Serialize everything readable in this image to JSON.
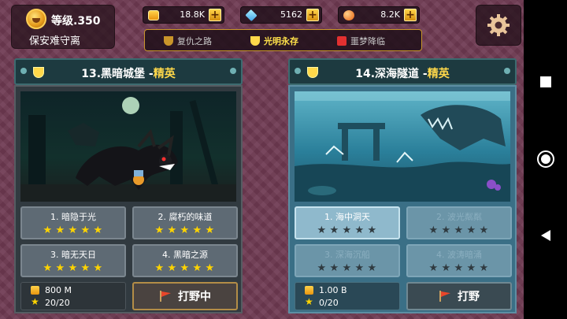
{
  "player": {
    "level": "等级.350",
    "name": "保安难守离"
  },
  "currencies": [
    {
      "icon": "gold-coin-icon",
      "value": "18.8K"
    },
    {
      "icon": "diamond-icon",
      "value": "5162"
    },
    {
      "icon": "energy-orb-icon",
      "value": "8.2K"
    }
  ],
  "tabs": [
    {
      "label": "复仇之路",
      "active": false
    },
    {
      "label": "光明永存",
      "active": true
    },
    {
      "label": "噩梦降临",
      "active": false
    }
  ],
  "cards": [
    {
      "title": "13.黑暗城堡 -",
      "tier": "精英",
      "stages": [
        {
          "name": "1. 暗隐于光",
          "stars": 5,
          "state": "cleared"
        },
        {
          "name": "2. 腐朽的味道",
          "stars": 5,
          "state": "cleared"
        },
        {
          "name": "3. 暗无天日",
          "stars": 5,
          "state": "cleared"
        },
        {
          "name": "4. 黑暗之源",
          "stars": 5,
          "state": "cleared"
        }
      ],
      "reward_gold": "800 M",
      "reward_stars": "20/20",
      "action": "打野中"
    },
    {
      "title": "14.深海隧道 -",
      "tier": "精英",
      "stages": [
        {
          "name": "1. 海中洞天",
          "stars": 0,
          "state": "selected"
        },
        {
          "name": "2. 波光粼粼",
          "stars": 0,
          "state": "locked"
        },
        {
          "name": "3. 深海沉船",
          "stars": 0,
          "state": "locked"
        },
        {
          "name": "4. 波涛暗涌",
          "stars": 0,
          "state": "locked"
        }
      ],
      "reward_gold": "1.00 B",
      "reward_stars": "0/20",
      "action": "打野"
    }
  ],
  "colors": {
    "elite": "#ffd84a",
    "star_gold": "#ffd400",
    "tab_active": "#ffe14a"
  }
}
